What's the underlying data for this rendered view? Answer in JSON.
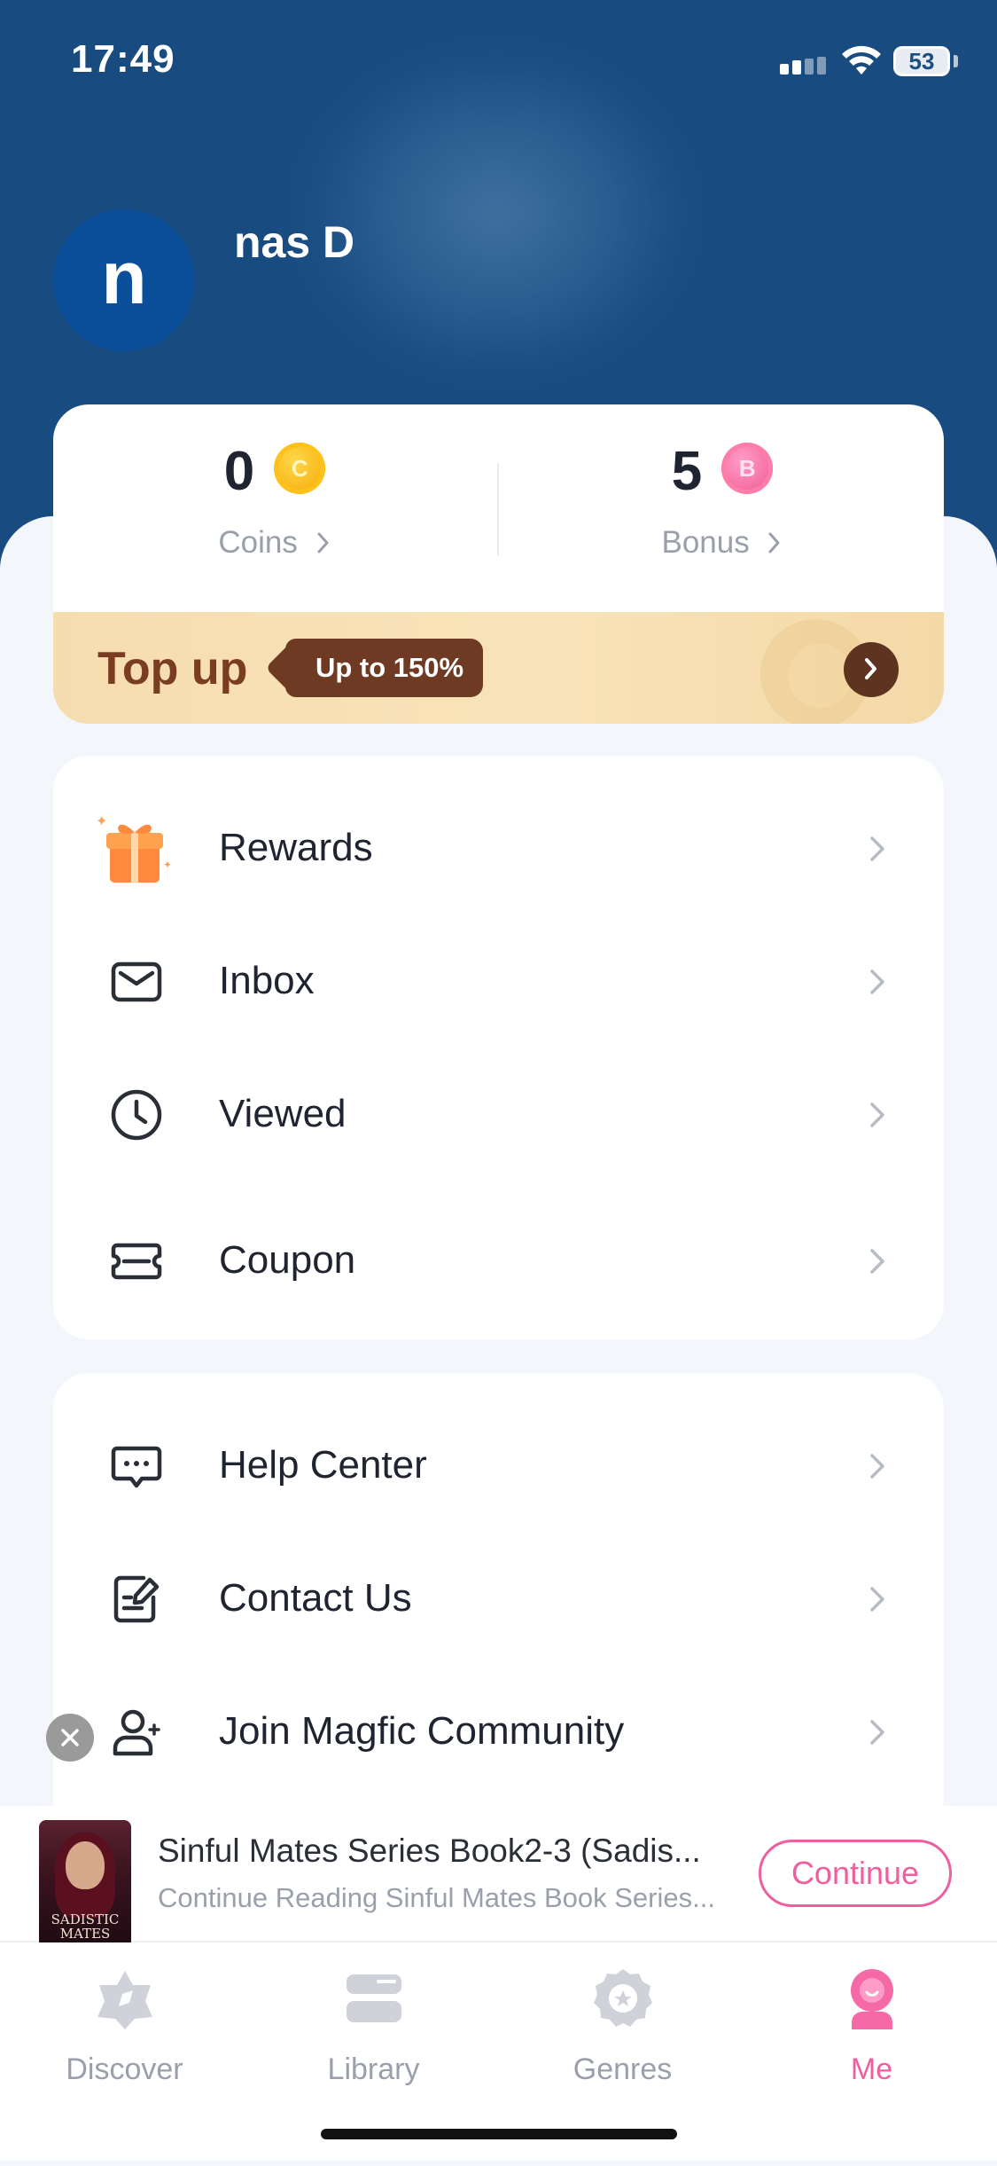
{
  "status_bar": {
    "time": "17:49",
    "battery": "53"
  },
  "profile": {
    "avatar_letter": "n",
    "name": "nas D"
  },
  "wallet": {
    "coins": {
      "value": "0",
      "label": "Coins",
      "icon_letter": "C"
    },
    "bonus": {
      "value": "5",
      "label": "Bonus",
      "icon_letter": "B"
    },
    "topup": {
      "title": "Top up",
      "badge": "Up to 150%"
    }
  },
  "menu_primary": [
    {
      "label": "Rewards",
      "icon": "gift-icon"
    },
    {
      "label": "Inbox",
      "icon": "mail-icon"
    },
    {
      "label": "Viewed",
      "icon": "clock-icon"
    },
    {
      "label": "Coupon",
      "icon": "ticket-icon"
    }
  ],
  "menu_secondary": [
    {
      "label": "Help Center",
      "icon": "chat-icon"
    },
    {
      "label": "Contact Us",
      "icon": "edit-note-icon"
    },
    {
      "label": "Join Magfic Community",
      "icon": "person-add-icon"
    }
  ],
  "continue_reading": {
    "cover_title": "SADISTIC MATES",
    "title": "Sinful Mates Series Book2-3 (Sadis...",
    "subtitle": "Continue Reading Sinful Mates Book Series...",
    "button": "Continue"
  },
  "tabs": [
    {
      "label": "Discover",
      "icon": "discover-icon",
      "active": false
    },
    {
      "label": "Library",
      "icon": "library-icon",
      "active": false
    },
    {
      "label": "Genres",
      "icon": "genres-icon",
      "active": false
    },
    {
      "label": "Me",
      "icon": "me-icon",
      "active": true
    }
  ],
  "colors": {
    "header": "#1b4e83",
    "accent": "#ef5f9f",
    "topup_text": "#7a3d22"
  }
}
